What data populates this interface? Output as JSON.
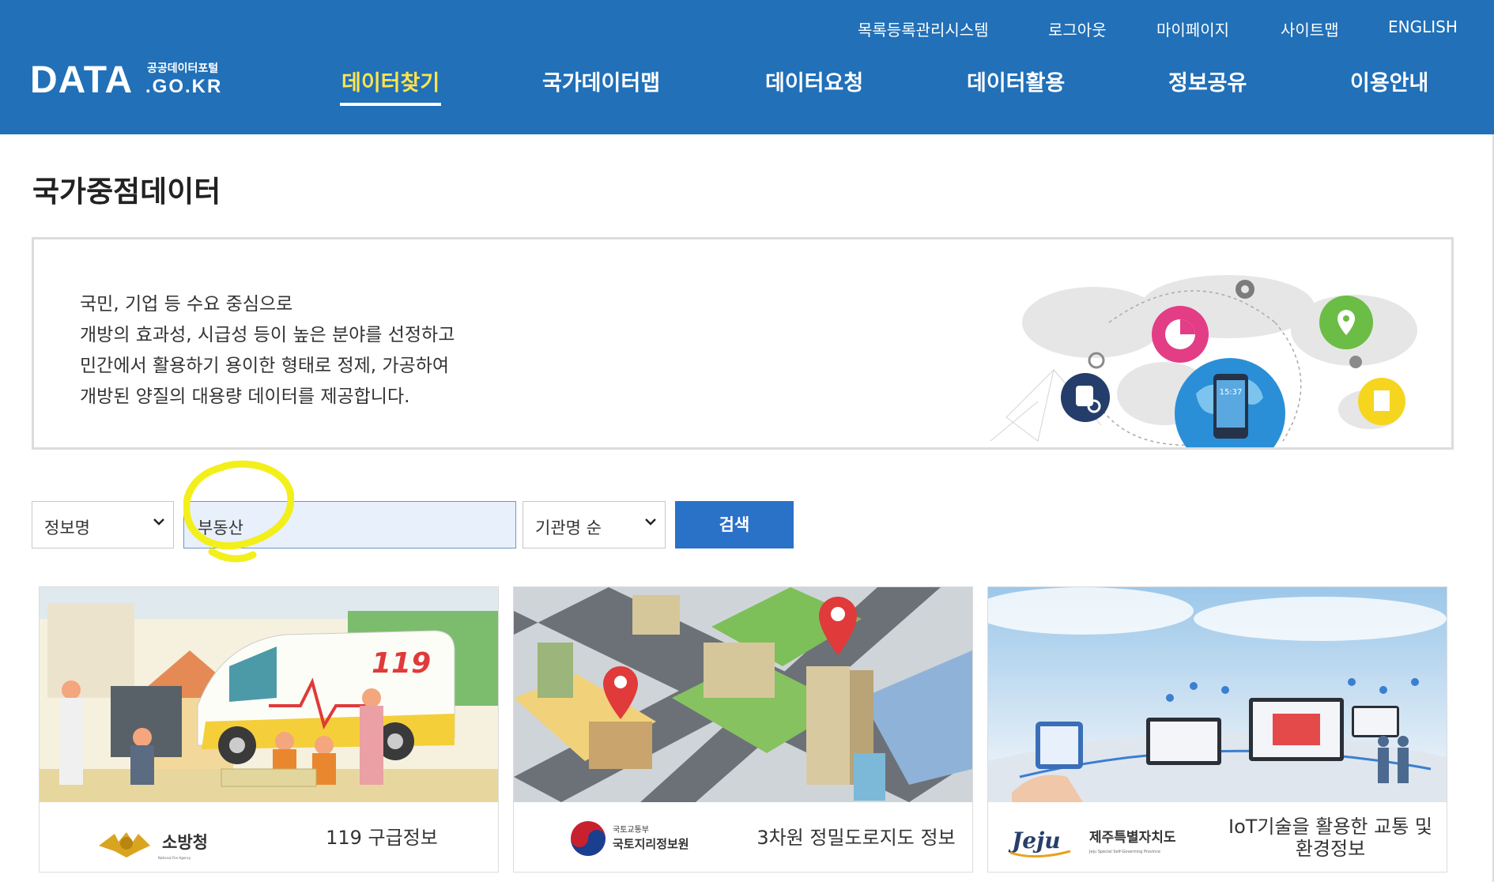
{
  "header": {
    "logo": {
      "main": "DATA",
      "small": "공공데이터포털",
      "sub": ".GO.KR"
    },
    "utility_links": [
      "목록등록관리시스템",
      "로그아웃",
      "마이페이지",
      "사이트맵",
      "ENGLISH"
    ],
    "nav": [
      "데이터찾기",
      "국가데이터맵",
      "데이터요청",
      "데이터활용",
      "정보공유",
      "이용안내"
    ],
    "active_nav": "데이터찾기"
  },
  "page": {
    "title": "국가중점데이터",
    "intro_lines": [
      "국민, 기업 등 수요 중심으로",
      "개방의 효과성, 시급성 등이 높은 분야를 선정하고",
      "민간에서 활용하기 용이한 형태로 정제, 가공하여",
      "개방된 양질의 대용량 데이터를 제공합니다."
    ],
    "illustration_phone_time": "15:37"
  },
  "search": {
    "field_select": "정보명",
    "query": "부동산",
    "sort_select": "기관명 순",
    "button": "검색"
  },
  "cards": [
    {
      "title": "119 구급정보",
      "org": "소방청",
      "org_sub": "National Fire Agency",
      "image_text": "119"
    },
    {
      "title": "3차원 정밀도로지도 정보",
      "org": "국토지리정보원",
      "org_top": "국토교통부"
    },
    {
      "title": "IoT기술을 활용한 교통 및 환경정보",
      "org": "제주특별자치도",
      "org_mark": "Jeju",
      "org_sub": "Jeju Special Self-Governing Province"
    }
  ],
  "colors": {
    "header_bg": "#2170b8",
    "active_nav": "#ffe44d",
    "search_button": "#2a71c8",
    "highlight": "#f3ef1a"
  }
}
